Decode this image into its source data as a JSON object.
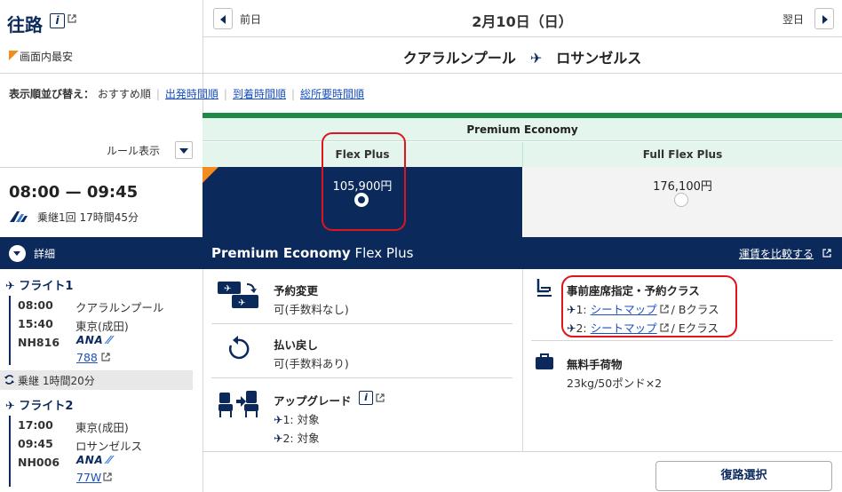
{
  "header": {
    "direction_title": "往路",
    "cheapest_label": "画面内最安",
    "prev_label": "前日",
    "next_label": "翌日",
    "date": "2月10日（日）",
    "origin": "クアラルンプール",
    "destination": "ロサンゼルス"
  },
  "sort": {
    "label": "表示順並び替え：",
    "current": "おすすめ順",
    "options": [
      "出発時間順",
      "到着時間順",
      "総所要時間順"
    ]
  },
  "rules": {
    "label": "ルール表示"
  },
  "flight": {
    "time_range": "08:00 — 09:45",
    "summary": "乗継1回 17時間45分"
  },
  "fares": {
    "cabin": "Premium Economy",
    "columns": [
      {
        "name": "Flex Plus",
        "price": "105,900円",
        "selected": true
      },
      {
        "name": "Full Flex Plus",
        "price": "176,100円",
        "selected": false
      }
    ]
  },
  "detail": {
    "label": "詳細",
    "fare_name_bold": "Premium Economy",
    "fare_name_rest": " Flex Plus",
    "compare_link": "運賃を比較する"
  },
  "segments": [
    {
      "head": "フライト1",
      "dep_time": "08:00",
      "dep_airport": "クアラルンプール",
      "arr_time": "15:40",
      "arr_airport": "東京(成田)",
      "flight_no": "NH816",
      "airline": "ANA",
      "aircraft": "788"
    },
    {
      "head": "フライト2",
      "dep_time": "17:00",
      "dep_airport": "東京(成田)",
      "arr_time": "09:45",
      "arr_airport": "ロサンゼルス",
      "flight_no": "NH006",
      "airline": "ANA",
      "aircraft": "77W"
    }
  ],
  "transfer": "乗継 1時間20分",
  "conditions": {
    "change": {
      "title": "予約変更",
      "value": "可(手数料なし)"
    },
    "refund": {
      "title": "払い戻し",
      "value": "可(手数料あり)"
    },
    "upgrade": {
      "title": "アップグレード",
      "line1_prefix": "1:",
      "line1": "対象",
      "line2_prefix": "2:",
      "line2": "対象"
    },
    "seat": {
      "title": "事前座席指定・予約クラス",
      "rows": [
        {
          "prefix": "1:",
          "link": "シートマップ",
          "class": "/ Bクラス"
        },
        {
          "prefix": "2:",
          "link": "シートマップ",
          "class": "/ Eクラス"
        }
      ]
    },
    "baggage": {
      "title": "無料手荷物",
      "value": "23kg/50ポンド×2"
    }
  },
  "return_button": "復路選択",
  "colors": {
    "navy": "#0b2a5b",
    "green": "#1e8a47",
    "mint": "#e3f5ec",
    "orange": "#f28c1f",
    "highlight": "#e0141e",
    "link": "#1a4fbf"
  }
}
